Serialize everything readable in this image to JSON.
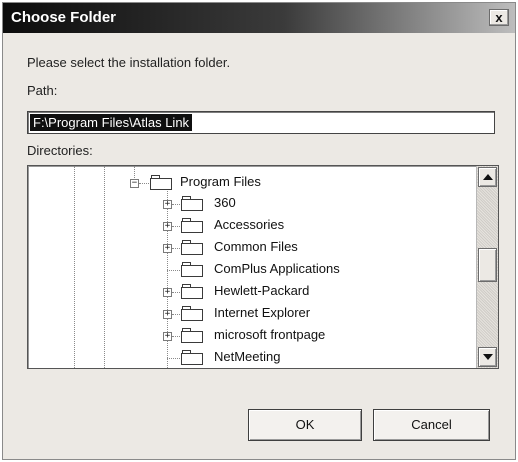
{
  "dialog": {
    "title": "Choose Folder",
    "close_label": "x",
    "instruction": "Please select the installation folder.",
    "path_label": "Path:",
    "path_value": "F:\\Program Files\\Atlas Link",
    "directories_label": "Directories:",
    "tree": {
      "root": {
        "label": "Program Files",
        "expander": "−"
      },
      "children": [
        {
          "label": "360",
          "expander": "+"
        },
        {
          "label": "Accessories",
          "expander": "+"
        },
        {
          "label": "Common Files",
          "expander": "+"
        },
        {
          "label": "ComPlus Applications",
          "expander": ""
        },
        {
          "label": "Hewlett-Packard",
          "expander": "+"
        },
        {
          "label": "Internet Explorer",
          "expander": "+"
        },
        {
          "label": "microsoft frontpage",
          "expander": "+"
        },
        {
          "label": "NetMeeting",
          "expander": ""
        }
      ]
    },
    "ok_label": "OK",
    "cancel_label": "Cancel"
  },
  "icons": {
    "close": "close-icon",
    "folder": "folder-icon",
    "scroll_up": "scroll-up-arrow-icon",
    "scroll_down": "scroll-down-arrow-icon"
  }
}
